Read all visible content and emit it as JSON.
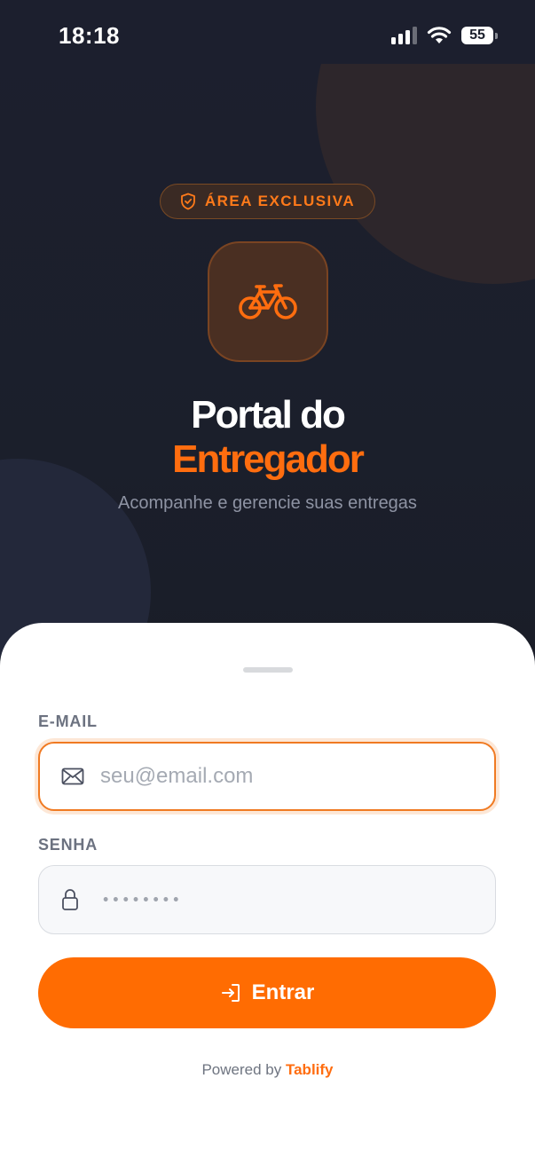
{
  "status_bar": {
    "time": "18:18",
    "battery": "55",
    "icons": [
      "signal-icon",
      "wifi-icon",
      "battery-icon"
    ]
  },
  "hero": {
    "badge_icon": "shield-icon",
    "badge_label": "ÁREA EXCLUSIVA",
    "app_icon": "bicycle-icon",
    "title_line1": "Portal do",
    "title_line2": "Entregador",
    "subtitle": "Acompanhe e gerencie suas entregas"
  },
  "form": {
    "email_label": "E-MAIL",
    "email_icon": "mail-icon",
    "email_placeholder": "seu@email.com",
    "password_label": "SENHA",
    "password_icon": "lock-icon",
    "password_mask": "••••••••",
    "submit_icon": "login-icon",
    "submit_label": "Entrar"
  },
  "footer": {
    "powered_by": "Powered by",
    "brand": "Tablify"
  },
  "colors": {
    "accent": "#ff6c02",
    "background": "#1b1f2c"
  }
}
